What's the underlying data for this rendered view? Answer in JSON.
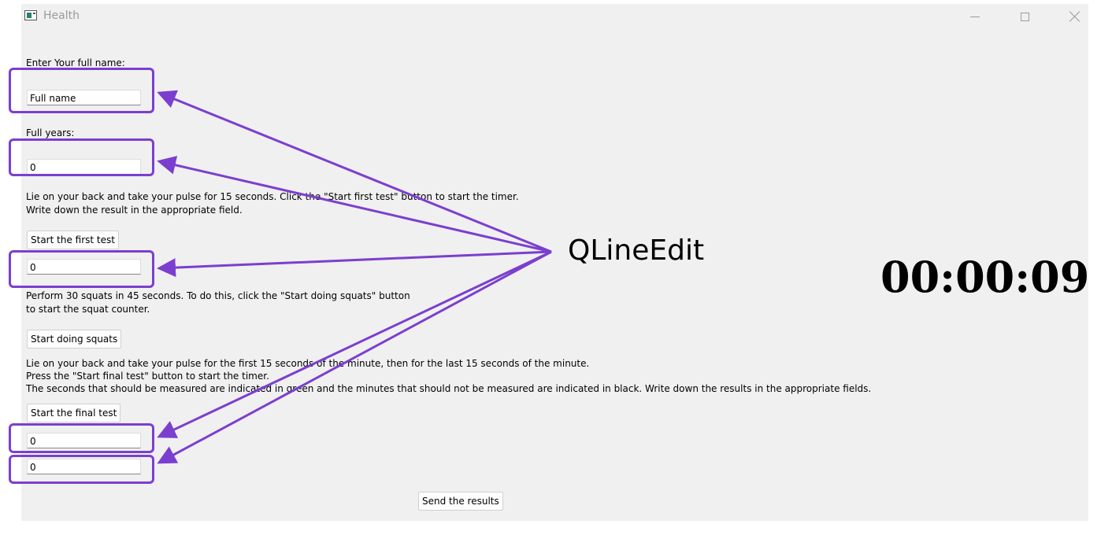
{
  "window": {
    "title": "Health",
    "icon": "app-window-icon",
    "controls": [
      "minimize-icon",
      "maximize-icon",
      "close-icon"
    ]
  },
  "form": {
    "name_label": "Enter Your full name:",
    "name_value": "Full name",
    "years_label": "Full years:",
    "years_value": "0",
    "instruction1_line1": "Lie on your back and take your pulse for 15 seconds. Click the \"Start first test\" button to start the timer.",
    "instruction1_line2": "Write down the result in the appropriate field.",
    "start_first_test": "Start the first test",
    "test1_value": "0",
    "instruction2_line1": "Perform 30 squats in 45 seconds. To do this, click the \"Start doing squats\" button",
    "instruction2_line2": "to start the squat counter.",
    "start_squats": "Start doing squats",
    "instruction3_line1": "Lie on your back and take your pulse for the first 15 seconds of the minute, then for the last 15 seconds of the minute.",
    "instruction3_line2": "Press the \"Start final test\" button to start the timer.",
    "instruction3_line3": "The seconds that should be measured are indicated in green and the minutes that should not be measured are indicated in black. Write down the results in the appropriate fields.",
    "start_final_test": "Start the final test",
    "test2_value": "0",
    "test3_value": "0",
    "send_results": "Send the results"
  },
  "timer": "00:00:09",
  "annotation": {
    "label": "QLineEdit",
    "color": "#7b3fcf"
  }
}
